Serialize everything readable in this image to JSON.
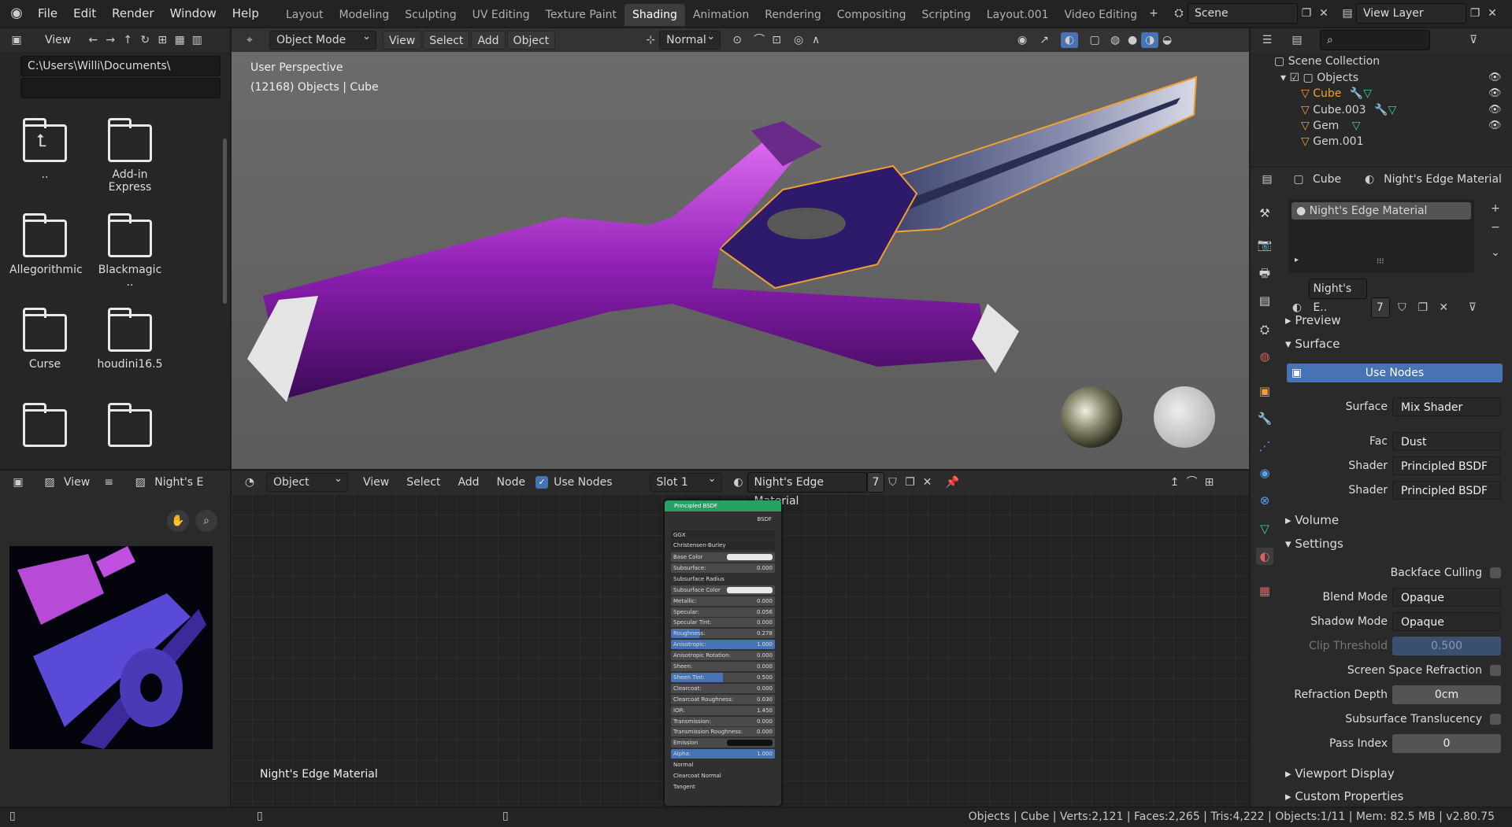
{
  "app": {
    "menus": [
      "File",
      "Edit",
      "Render",
      "Window",
      "Help"
    ],
    "workspaces": [
      "Layout",
      "Modeling",
      "Sculpting",
      "UV Editing",
      "Texture Paint",
      "Shading",
      "Animation",
      "Rendering",
      "Compositing",
      "Scripting",
      "Layout.001",
      "Video Editing"
    ],
    "active_workspace": "Shading",
    "scene": "Scene",
    "view_layer": "View Layer"
  },
  "file_browser": {
    "view_label": "View",
    "path": "C:\\Users\\Willi\\Documents\\",
    "filter": "",
    "folders": [
      "..",
      "Add-in Express",
      "Allegorithmic",
      "Blackmagic ..",
      "Curse",
      "houdini16.5",
      "",
      ""
    ]
  },
  "viewport": {
    "mode": "Object Mode",
    "menus": [
      "View",
      "Select",
      "Add",
      "Object"
    ],
    "orientation": "Normal",
    "overlay_line1": "User Perspective",
    "overlay_line2": "(12168) Objects | Cube"
  },
  "image_editor": {
    "view_label": "View",
    "image_name": "Night's E"
  },
  "node_editor": {
    "type": "Object",
    "menus": [
      "View",
      "Select",
      "Add",
      "Node"
    ],
    "use_nodes": "Use Nodes",
    "slot": "Slot 1",
    "material": "Night's Edge Material",
    "users": "7",
    "footer": "Night's Edge Material",
    "node": {
      "title": "Principled BSDF",
      "out": "BSDF",
      "dist": "GGX",
      "sss": "Christensen-Burley",
      "rows": [
        {
          "l": "Base Color",
          "v": "",
          "c": "#e8e8e8"
        },
        {
          "l": "Subsurface:",
          "v": "0.000"
        },
        {
          "l": "Subsurface Radius",
          "v": ""
        },
        {
          "l": "Subsurface Color",
          "v": "",
          "c": "#e8e8e8"
        },
        {
          "l": "Metallic:",
          "v": "0.000"
        },
        {
          "l": "Specular:",
          "v": "0.056"
        },
        {
          "l": "Specular Tint:",
          "v": "0.000"
        },
        {
          "l": "Roughness:",
          "v": "0.278",
          "f": 0.278
        },
        {
          "l": "Anisotropic:",
          "v": "1.000",
          "f": 1
        },
        {
          "l": "Anisotropic Rotation:",
          "v": "0.000"
        },
        {
          "l": "Sheen:",
          "v": "0.000"
        },
        {
          "l": "Sheen Tint:",
          "v": "0.500",
          "f": 0.5
        },
        {
          "l": "Clearcoat:",
          "v": "0.000"
        },
        {
          "l": "Clearcoat Roughness:",
          "v": "0.030"
        },
        {
          "l": "IOR:",
          "v": "1.450"
        },
        {
          "l": "Transmission:",
          "v": "0.000"
        },
        {
          "l": "Transmission Roughness:",
          "v": "0.000"
        },
        {
          "l": "Emission",
          "v": "",
          "c": "#111111"
        },
        {
          "l": "Alpha:",
          "v": "1.000",
          "f": 1
        },
        {
          "l": "Normal",
          "v": ""
        },
        {
          "l": "Clearcoat Normal",
          "v": ""
        },
        {
          "l": "Tangent",
          "v": ""
        }
      ]
    }
  },
  "outliner": {
    "root": "Scene Collection",
    "collection": "Objects",
    "items": [
      "Cube",
      "Cube.003",
      "Gem",
      "Gem.001"
    ]
  },
  "properties": {
    "object": "Cube",
    "material_name": "Night's Edge Material",
    "slot_name": "Night's Edge Material",
    "mat_field": "Night's E..",
    "users": "7",
    "sections": {
      "preview": "Preview",
      "surface": "Surface",
      "volume": "Volume",
      "settings": "Settings",
      "viewport_display": "Viewport Display",
      "custom_properties": "Custom Properties"
    },
    "use_nodes": "Use Nodes",
    "surface_rows": [
      {
        "label": "Surface",
        "value": "Mix Shader"
      },
      {
        "label": "Fac",
        "value": "Dust"
      },
      {
        "label": "Shader",
        "value": "Principled BSDF"
      },
      {
        "label": "Shader",
        "value": "Principled BSDF"
      }
    ],
    "settings": {
      "backface": "Backface Culling",
      "blend_label": "Blend Mode",
      "blend": "Opaque",
      "shadow_label": "Shadow Mode",
      "shadow": "Opaque",
      "clip_label": "Clip Threshold",
      "clip": "0.500",
      "ssr": "Screen Space Refraction",
      "refr_label": "Refraction Depth",
      "refr": "0cm",
      "sst": "Subsurface Translucency",
      "pass_label": "Pass Index",
      "pass": "0"
    }
  },
  "status": {
    "text": "Objects | Cube | Verts:2,121 | Faces:2,265 | Tris:4,222 | Objects:1/11 | Mem: 82.5 MB | v2.80.75"
  },
  "colors": {
    "accent": "#4772b3",
    "header": "#2b2b2b",
    "orange": "#f0a030",
    "node_header": "#27a063"
  }
}
